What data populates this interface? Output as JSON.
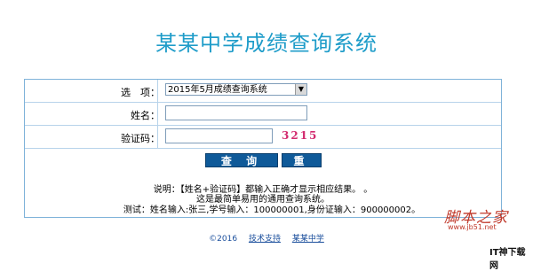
{
  "title": "某某中学成绩查询系统",
  "form": {
    "option_label": "选　项：",
    "option_selected": "2015年5月成绩查询系统",
    "name_label": "姓名：",
    "captcha_label": "验证码：",
    "captcha_code": "3215"
  },
  "buttons": {
    "query": "查 询",
    "reset": "重 置"
  },
  "notes": {
    "line1": "说明：【姓名+验证码】都输入正确才显示相应结果。 。",
    "line2": "这是最简单易用的通用查询系统。",
    "line3": "测试：姓名输入:张三,学号输入：100000001,身份证输入：900000002。"
  },
  "footer": {
    "copyright": "©2016",
    "support": "技术支持",
    "school": "某某中学"
  },
  "watermarks": {
    "site_logo": "脚本之家",
    "site_url": "www.jb51.net",
    "brand": "IT神下载网"
  }
}
